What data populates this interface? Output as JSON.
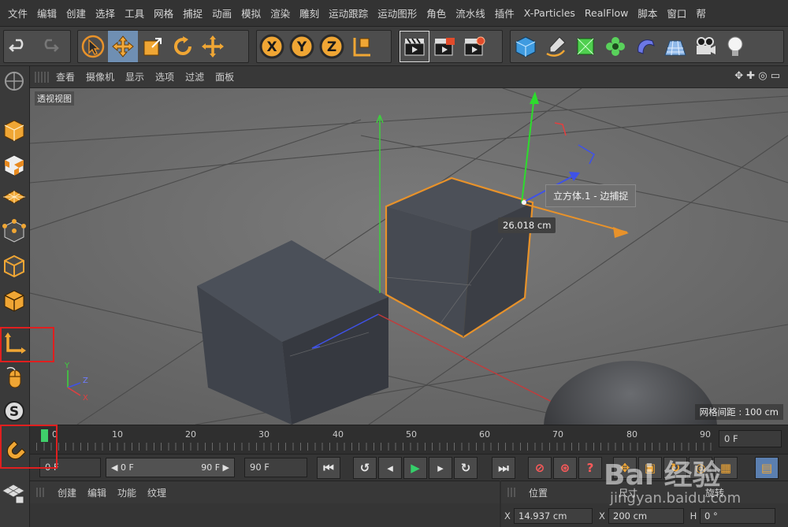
{
  "menubar": {
    "items": [
      "文件",
      "编辑",
      "创建",
      "选择",
      "工具",
      "网格",
      "捕捉",
      "动画",
      "模拟",
      "渲染",
      "雕刻",
      "运动跟踪",
      "运动图形",
      "角色",
      "流水线",
      "插件",
      "X-Particles",
      "RealFlow",
      "脚本",
      "窗口",
      "帮"
    ]
  },
  "toolbar": {
    "axis_x": "X",
    "axis_y": "Y",
    "axis_z": "Z"
  },
  "viewport_menu": {
    "items": [
      "查看",
      "摄像机",
      "显示",
      "选项",
      "过滤",
      "面板"
    ],
    "nav_icons": "✥ ✚ ◎ ▭"
  },
  "viewport": {
    "label": "透视视图",
    "tooltip": "立方体.1 - 边捕捉",
    "dimension": "26.018 cm",
    "grid_spacing": "网格间距 : 100 cm",
    "mini_axis": {
      "y": "Y",
      "z": "Z",
      "x": "X"
    }
  },
  "timeline": {
    "ticks": [
      "0",
      "10",
      "20",
      "30",
      "40",
      "50",
      "60",
      "70",
      "80",
      "90"
    ],
    "current_frame": "0 F"
  },
  "transport": {
    "start_field": "0 F",
    "range_start": "◀ 0 F",
    "range_end": "90 F ▶",
    "end_field": "90 F"
  },
  "bottom_left_panel": {
    "tabs": [
      "创建",
      "编辑",
      "功能",
      "纹理"
    ]
  },
  "bottom_right_panel": {
    "title": "位置",
    "size_title": "尺寸",
    "rotation_title": "旋转",
    "x_label": "X",
    "x_value": "14.937 cm",
    "size_x_label": "X",
    "size_x_value": "200 cm",
    "h_label": "H",
    "h_value": "0 °"
  },
  "watermark": {
    "text": "Bai 经验",
    "url": "jingyan.baidu.com"
  },
  "colors": {
    "selection_orange": "#e8922a",
    "axis_green": "#3ecf3e",
    "axis_red": "#e04040",
    "axis_blue": "#3f52e8",
    "highlight_red": "#e01f1f",
    "playhead_green": "#3fcf6a"
  }
}
